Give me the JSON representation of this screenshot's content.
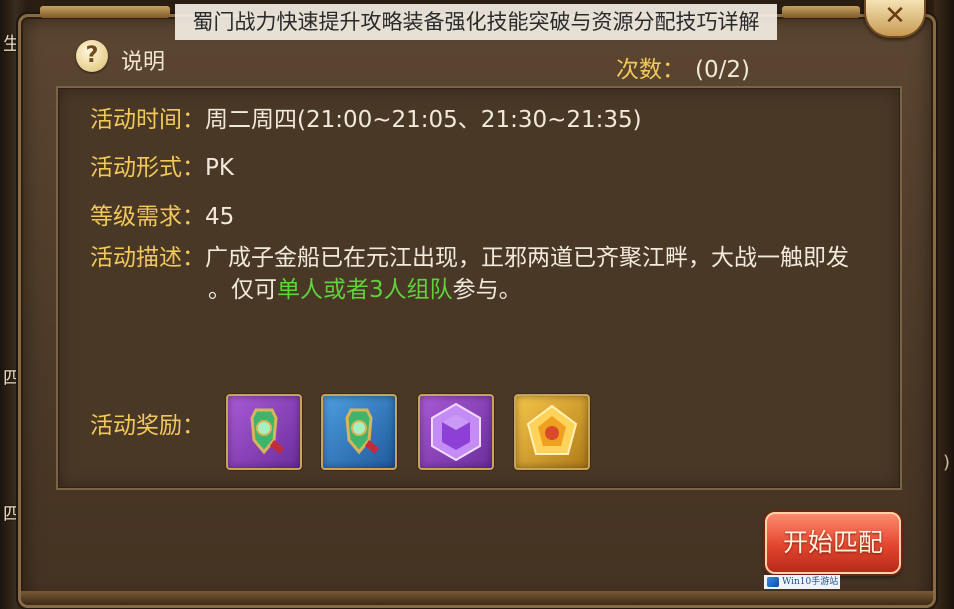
{
  "title": "蜀门战力快速提升攻略装备强化技能突破与资源分配技巧详解",
  "close_glyph": "✕",
  "help": {
    "icon_glyph": "?",
    "label": "说明"
  },
  "count": {
    "label": "次数：",
    "value": "(0/2)"
  },
  "info": [
    {
      "label": "活动时间：",
      "value": "周二周四(21:00~21:05、21:30~21:35)"
    },
    {
      "label": "活动形式：",
      "value": "PK"
    },
    {
      "label": "等级需求：",
      "value": "45"
    }
  ],
  "description": {
    "label": "活动描述：",
    "line1": "广成子金船已在元江出现，正邪两道已齐聚江畔，大战一触即发",
    "line2_pre": "。仅可",
    "line2_highlight": "单人或者3人组队",
    "line2_post": "参与。"
  },
  "rewards": {
    "label": "活动奖励：",
    "items": [
      {
        "icon": "jade-medallion-icon",
        "frame": "purple"
      },
      {
        "icon": "jade-medallion-icon",
        "frame": "blue"
      },
      {
        "icon": "purple-gem-icon",
        "frame": "purple"
      },
      {
        "icon": "gold-pentagon-gem-icon",
        "frame": "gold"
      }
    ]
  },
  "start_button": "开始匹配",
  "side_chips": {
    "left_top": "生",
    "left_mid": "四",
    "left_bottom": "四",
    "right": ")"
  },
  "watermark": "Win10手游站",
  "colors": {
    "label_gold": "#f1c85a",
    "text_light": "#f1eadb",
    "highlight_green": "#5fd23c",
    "button_red": "#e2452e"
  }
}
